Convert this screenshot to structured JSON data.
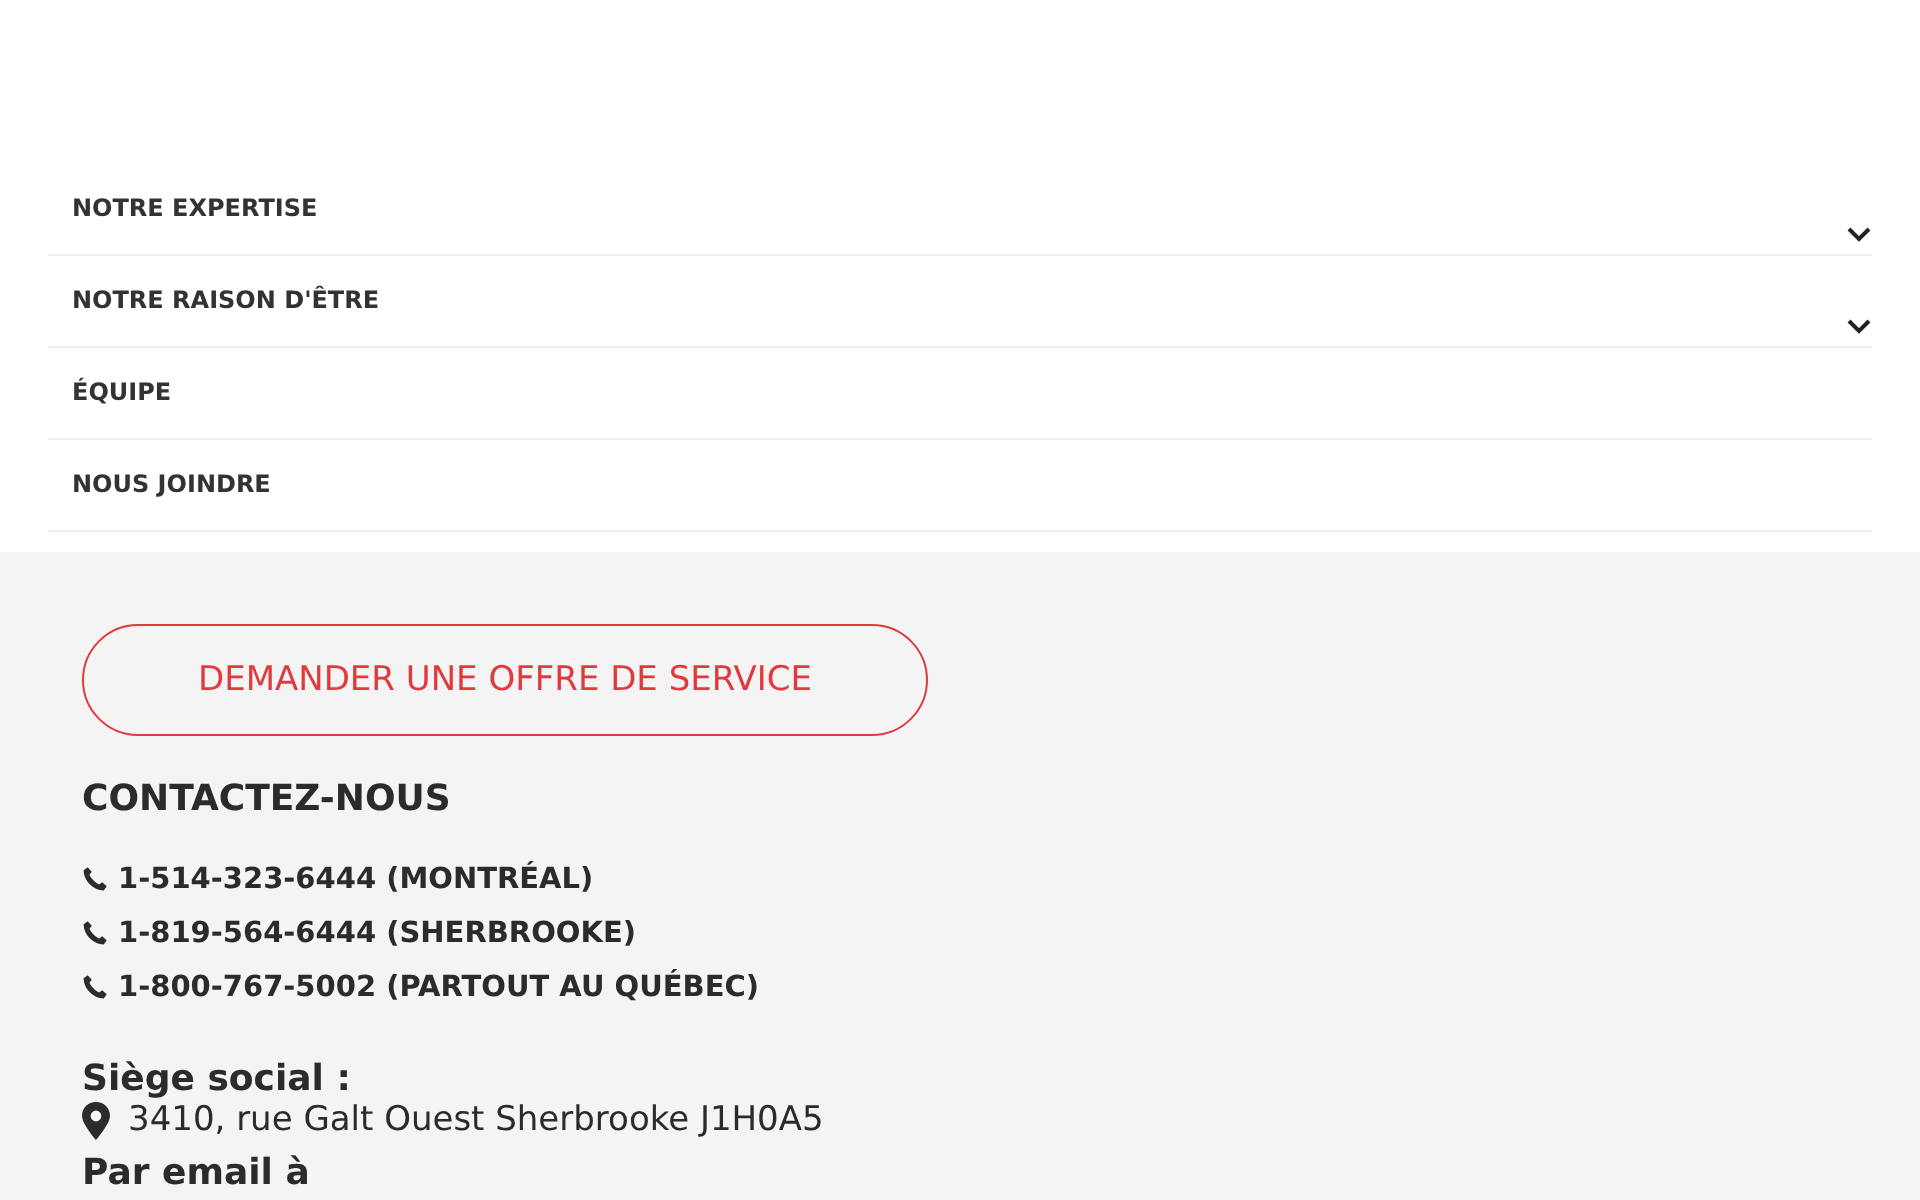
{
  "menu": [
    {
      "label": "NOTRE EXPERTISE",
      "expandable": true
    },
    {
      "label": "NOTRE RAISON D'ÊTRE",
      "expandable": true
    },
    {
      "label": "ÉQUIPE",
      "expandable": false
    },
    {
      "label": "NOUS JOINDRE",
      "expandable": false
    }
  ],
  "cta_button": "DEMANDER UNE OFFRE DE SERVICE",
  "contact": {
    "heading": "CONTACTEZ-NOUS",
    "phones": [
      "1-514-323-6444 (MONTRÉAL)",
      "1-819-564-6444 (SHERBROOKE)",
      "1-800-767-5002 (PARTOUT AU QUÉBEC)"
    ],
    "head_office_label": "Siège social :",
    "address": "3410, rue Galt Ouest Sherbrooke J1H0A5",
    "email_label": "Par email à"
  }
}
